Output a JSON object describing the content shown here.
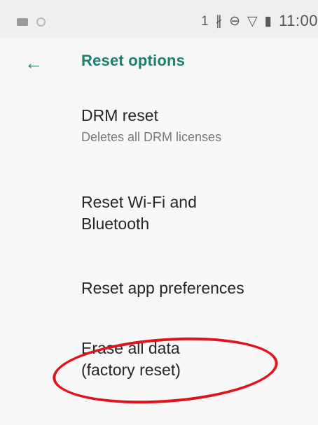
{
  "status_bar": {
    "left_icons": [
      "image-icon",
      "circle-icon"
    ],
    "right_icons": [
      "notification-1-icon",
      "bluetooth-icon",
      "do-not-disturb-icon",
      "wifi-icon",
      "battery-icon"
    ],
    "time": "11:00"
  },
  "app_bar": {
    "back_icon": "arrow-left-icon",
    "title": "Reset options"
  },
  "options": {
    "drm": {
      "title": "DRM reset",
      "summary": "Deletes all DRM licenses"
    },
    "wifi": {
      "title": "Reset Wi-Fi and Bluetooth"
    },
    "apps": {
      "title": "Reset app preferences"
    },
    "erase": {
      "title": "Erase all data (factory reset)"
    }
  },
  "colors": {
    "accent": "#1a7f6e",
    "highlight": "#e0141a",
    "background": "#f8f8f8"
  }
}
